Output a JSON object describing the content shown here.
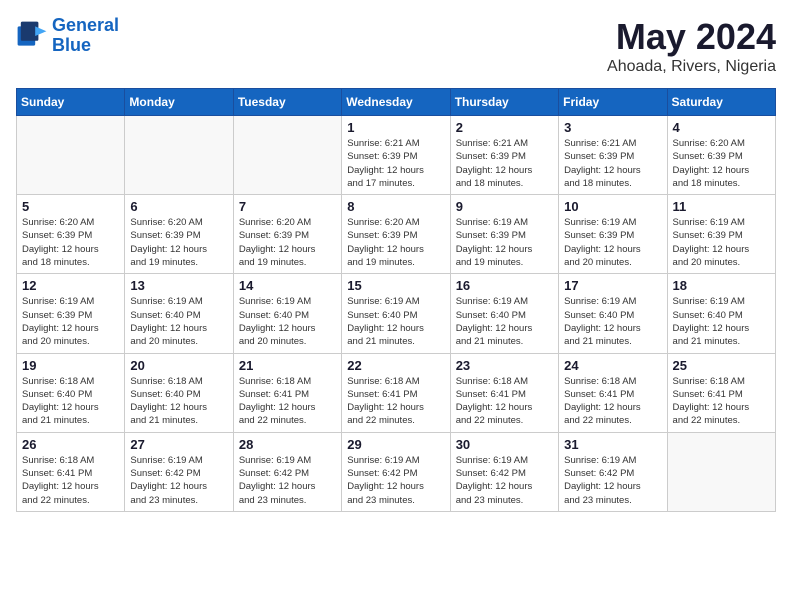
{
  "header": {
    "logo_line1": "General",
    "logo_line2": "Blue",
    "month": "May 2024",
    "location": "Ahoada, Rivers, Nigeria"
  },
  "weekdays": [
    "Sunday",
    "Monday",
    "Tuesday",
    "Wednesday",
    "Thursday",
    "Friday",
    "Saturday"
  ],
  "weeks": [
    [
      {
        "day": "",
        "info": ""
      },
      {
        "day": "",
        "info": ""
      },
      {
        "day": "",
        "info": ""
      },
      {
        "day": "1",
        "info": "Sunrise: 6:21 AM\nSunset: 6:39 PM\nDaylight: 12 hours\nand 17 minutes."
      },
      {
        "day": "2",
        "info": "Sunrise: 6:21 AM\nSunset: 6:39 PM\nDaylight: 12 hours\nand 18 minutes."
      },
      {
        "day": "3",
        "info": "Sunrise: 6:21 AM\nSunset: 6:39 PM\nDaylight: 12 hours\nand 18 minutes."
      },
      {
        "day": "4",
        "info": "Sunrise: 6:20 AM\nSunset: 6:39 PM\nDaylight: 12 hours\nand 18 minutes."
      }
    ],
    [
      {
        "day": "5",
        "info": "Sunrise: 6:20 AM\nSunset: 6:39 PM\nDaylight: 12 hours\nand 18 minutes."
      },
      {
        "day": "6",
        "info": "Sunrise: 6:20 AM\nSunset: 6:39 PM\nDaylight: 12 hours\nand 19 minutes."
      },
      {
        "day": "7",
        "info": "Sunrise: 6:20 AM\nSunset: 6:39 PM\nDaylight: 12 hours\nand 19 minutes."
      },
      {
        "day": "8",
        "info": "Sunrise: 6:20 AM\nSunset: 6:39 PM\nDaylight: 12 hours\nand 19 minutes."
      },
      {
        "day": "9",
        "info": "Sunrise: 6:19 AM\nSunset: 6:39 PM\nDaylight: 12 hours\nand 19 minutes."
      },
      {
        "day": "10",
        "info": "Sunrise: 6:19 AM\nSunset: 6:39 PM\nDaylight: 12 hours\nand 20 minutes."
      },
      {
        "day": "11",
        "info": "Sunrise: 6:19 AM\nSunset: 6:39 PM\nDaylight: 12 hours\nand 20 minutes."
      }
    ],
    [
      {
        "day": "12",
        "info": "Sunrise: 6:19 AM\nSunset: 6:39 PM\nDaylight: 12 hours\nand 20 minutes."
      },
      {
        "day": "13",
        "info": "Sunrise: 6:19 AM\nSunset: 6:40 PM\nDaylight: 12 hours\nand 20 minutes."
      },
      {
        "day": "14",
        "info": "Sunrise: 6:19 AM\nSunset: 6:40 PM\nDaylight: 12 hours\nand 20 minutes."
      },
      {
        "day": "15",
        "info": "Sunrise: 6:19 AM\nSunset: 6:40 PM\nDaylight: 12 hours\nand 21 minutes."
      },
      {
        "day": "16",
        "info": "Sunrise: 6:19 AM\nSunset: 6:40 PM\nDaylight: 12 hours\nand 21 minutes."
      },
      {
        "day": "17",
        "info": "Sunrise: 6:19 AM\nSunset: 6:40 PM\nDaylight: 12 hours\nand 21 minutes."
      },
      {
        "day": "18",
        "info": "Sunrise: 6:19 AM\nSunset: 6:40 PM\nDaylight: 12 hours\nand 21 minutes."
      }
    ],
    [
      {
        "day": "19",
        "info": "Sunrise: 6:18 AM\nSunset: 6:40 PM\nDaylight: 12 hours\nand 21 minutes."
      },
      {
        "day": "20",
        "info": "Sunrise: 6:18 AM\nSunset: 6:40 PM\nDaylight: 12 hours\nand 21 minutes."
      },
      {
        "day": "21",
        "info": "Sunrise: 6:18 AM\nSunset: 6:41 PM\nDaylight: 12 hours\nand 22 minutes."
      },
      {
        "day": "22",
        "info": "Sunrise: 6:18 AM\nSunset: 6:41 PM\nDaylight: 12 hours\nand 22 minutes."
      },
      {
        "day": "23",
        "info": "Sunrise: 6:18 AM\nSunset: 6:41 PM\nDaylight: 12 hours\nand 22 minutes."
      },
      {
        "day": "24",
        "info": "Sunrise: 6:18 AM\nSunset: 6:41 PM\nDaylight: 12 hours\nand 22 minutes."
      },
      {
        "day": "25",
        "info": "Sunrise: 6:18 AM\nSunset: 6:41 PM\nDaylight: 12 hours\nand 22 minutes."
      }
    ],
    [
      {
        "day": "26",
        "info": "Sunrise: 6:18 AM\nSunset: 6:41 PM\nDaylight: 12 hours\nand 22 minutes."
      },
      {
        "day": "27",
        "info": "Sunrise: 6:19 AM\nSunset: 6:42 PM\nDaylight: 12 hours\nand 23 minutes."
      },
      {
        "day": "28",
        "info": "Sunrise: 6:19 AM\nSunset: 6:42 PM\nDaylight: 12 hours\nand 23 minutes."
      },
      {
        "day": "29",
        "info": "Sunrise: 6:19 AM\nSunset: 6:42 PM\nDaylight: 12 hours\nand 23 minutes."
      },
      {
        "day": "30",
        "info": "Sunrise: 6:19 AM\nSunset: 6:42 PM\nDaylight: 12 hours\nand 23 minutes."
      },
      {
        "day": "31",
        "info": "Sunrise: 6:19 AM\nSunset: 6:42 PM\nDaylight: 12 hours\nand 23 minutes."
      },
      {
        "day": "",
        "info": ""
      }
    ]
  ]
}
